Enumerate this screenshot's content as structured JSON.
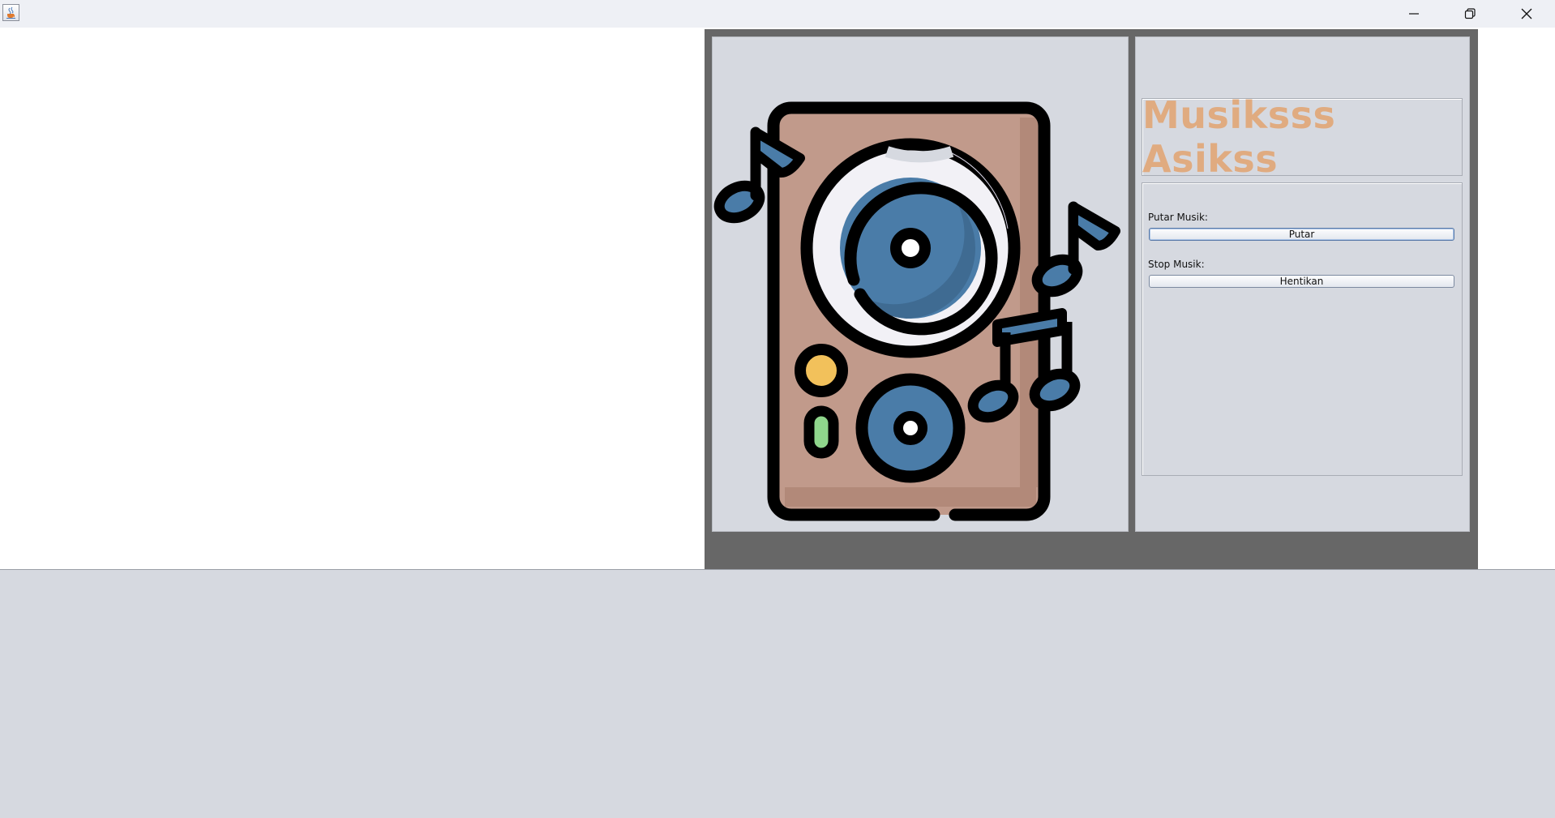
{
  "window": {
    "icon": "java-coffee-cup-icon",
    "controls": {
      "minimize_icon": "minimize-icon",
      "restore_icon": "restore-icon",
      "close_icon": "close-icon"
    }
  },
  "illustration": {
    "icon": "speaker-with-music-notes-illustration",
    "colors": {
      "cabinet": "#c19a8b",
      "cone": "#4a7ca8",
      "outline": "#000000",
      "knob": "#f2c15b",
      "indicator": "#8fd68c"
    }
  },
  "app": {
    "title": "Musiksss Asikss",
    "title_color": "#e0ab80",
    "play": {
      "label": "Putar Musik:",
      "button": "Putar"
    },
    "stop": {
      "label": "Stop Musik:",
      "button": "Hentikan"
    }
  }
}
